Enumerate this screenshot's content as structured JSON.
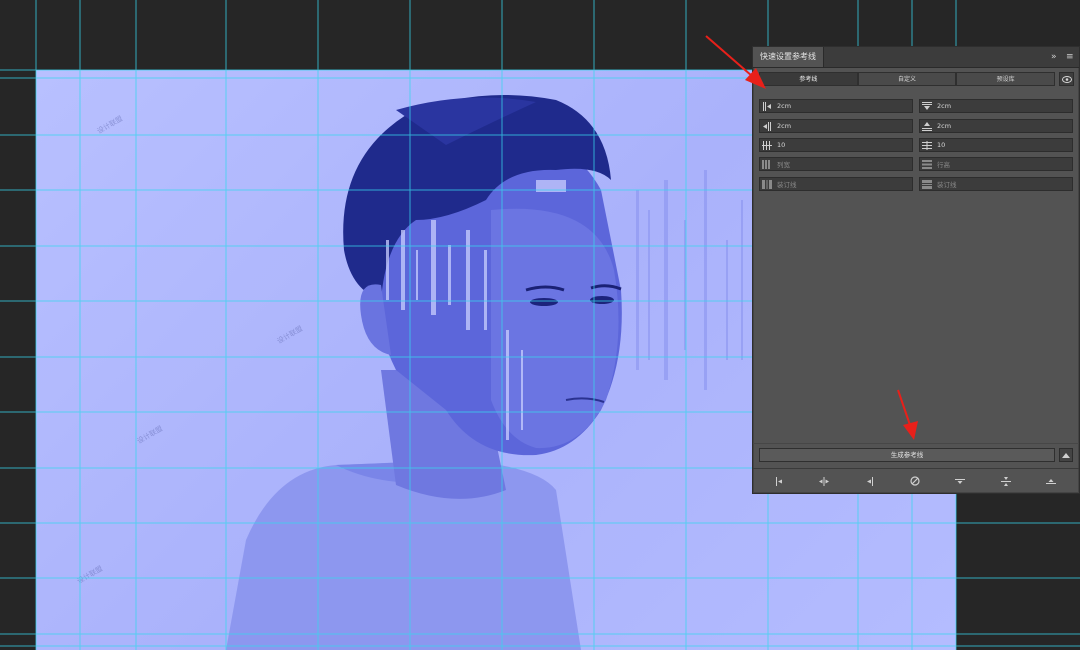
{
  "panel": {
    "title": "快速设置参考线",
    "tabs": [
      {
        "label": "参考线"
      },
      {
        "label": "自定义"
      },
      {
        "label": "预设库"
      }
    ],
    "fields_left": [
      {
        "value": "2cm",
        "icon": "margin-left-icon"
      },
      {
        "value": "2cm",
        "icon": "margin-right-icon"
      },
      {
        "value": "10",
        "icon": "columns-icon"
      },
      {
        "value": "列宽",
        "icon": "column-width-icon"
      },
      {
        "value": "装订线",
        "icon": "gutter-vertical-icon"
      }
    ],
    "fields_right": [
      {
        "value": "2cm",
        "icon": "margin-top-icon"
      },
      {
        "value": "2cm",
        "icon": "margin-bottom-icon"
      },
      {
        "value": "10",
        "icon": "rows-icon"
      },
      {
        "value": "行高",
        "icon": "row-height-icon"
      },
      {
        "value": "装订线",
        "icon": "gutter-horizontal-icon"
      }
    ],
    "generate_label": "生成参考线"
  },
  "watermark": "设计联盟",
  "colors": {
    "accent_arrow": "#e8201a",
    "guide": "#38d6ee",
    "panel_bg": "#535353",
    "doc_bg": "#b4bcff"
  }
}
